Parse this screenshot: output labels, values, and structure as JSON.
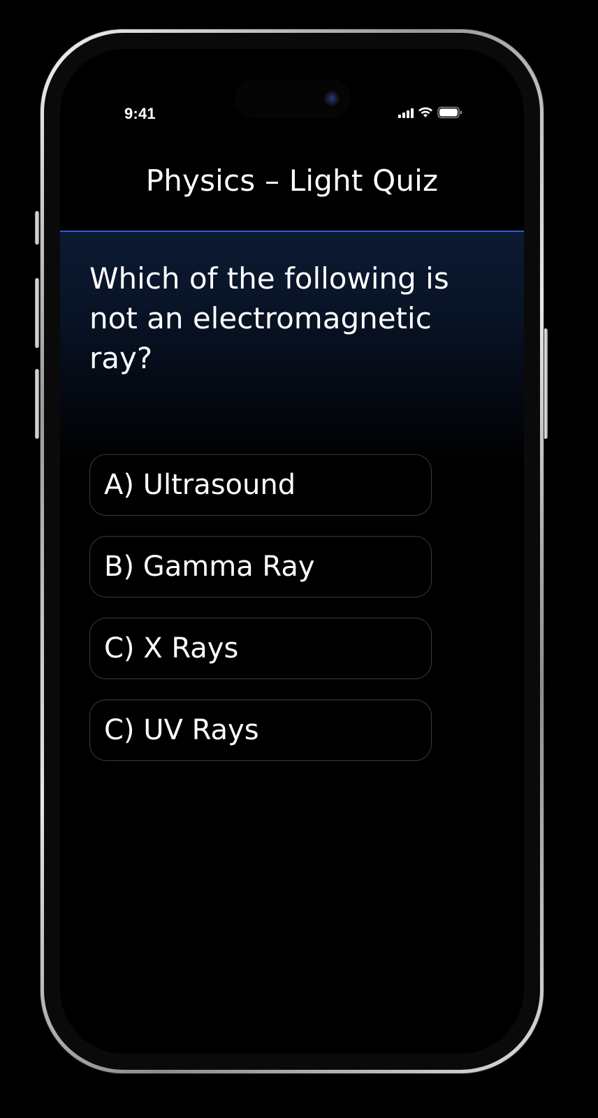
{
  "status_bar": {
    "time": "9:41",
    "icons": [
      "signal-icon",
      "wifi-icon",
      "battery-icon"
    ]
  },
  "header": {
    "title": "Physics – Light Quiz"
  },
  "question": {
    "text": "Which of the following is not an electromagnetic ray?"
  },
  "options": [
    {
      "label": "A) Ultrasound"
    },
    {
      "label": "B) Gamma Ray"
    },
    {
      "label": "C) X Rays"
    },
    {
      "label": "C) UV Rays"
    }
  ],
  "colors": {
    "background": "#000000",
    "accent_divider": "#2f5fd0",
    "option_border": "#3a3a3a",
    "text": "#ffffff"
  }
}
